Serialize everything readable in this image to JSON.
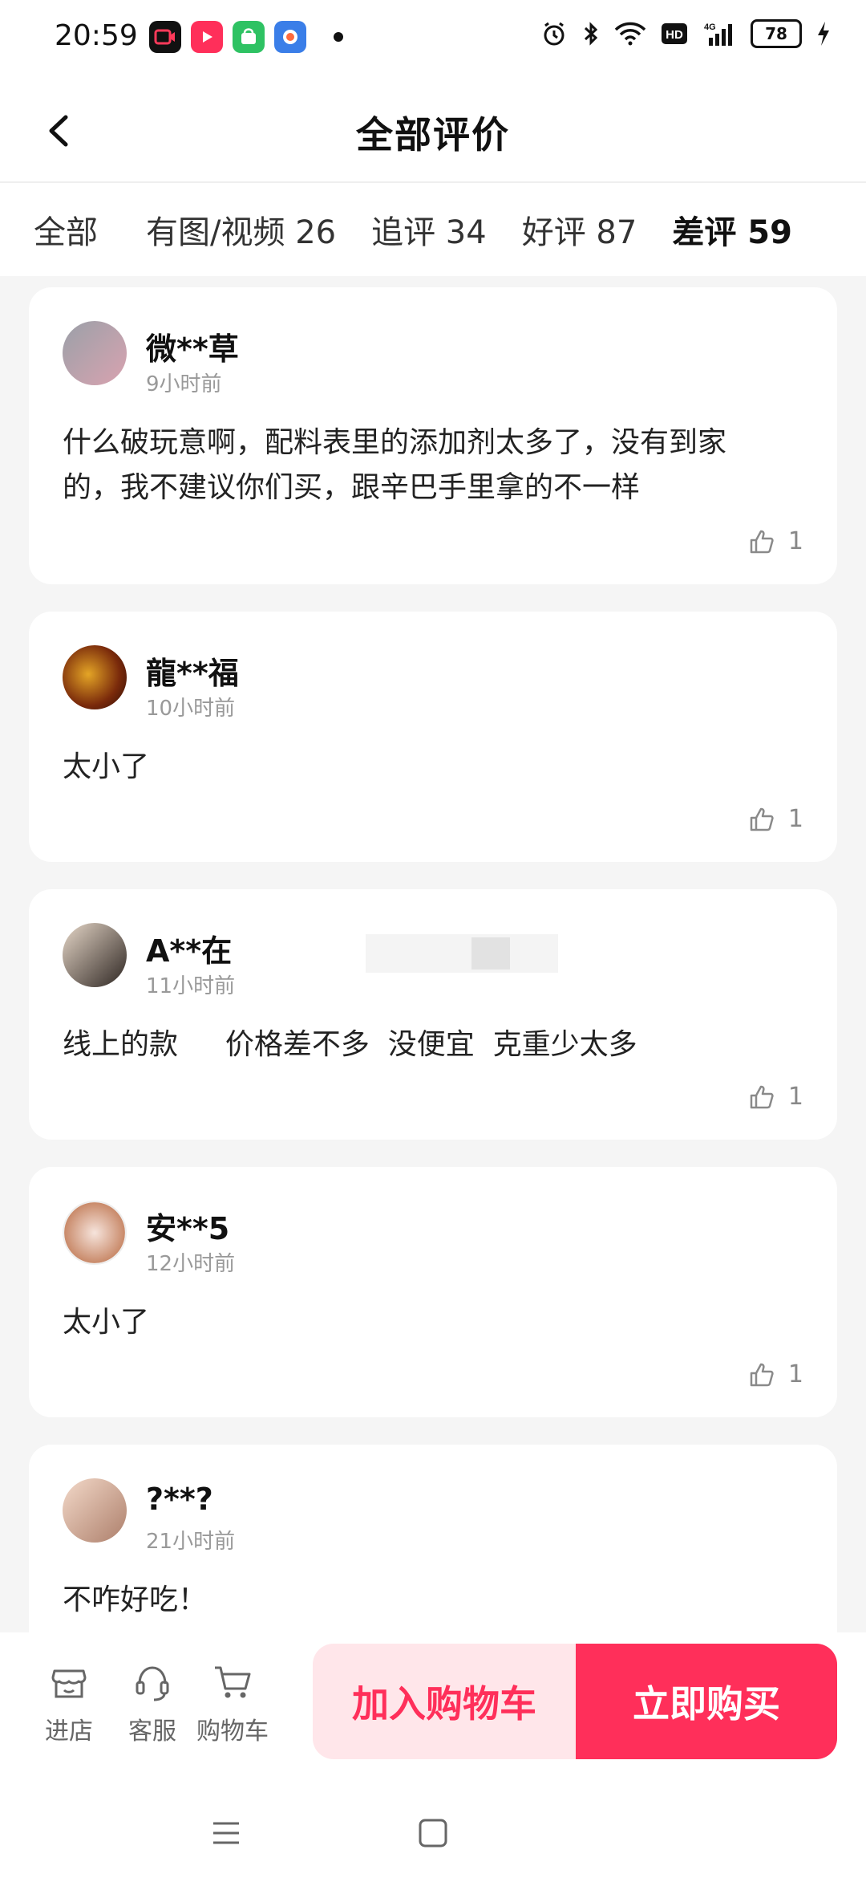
{
  "status_bar": {
    "time": "20:59",
    "battery": "78",
    "app_icons": [
      "screen-recorder-icon",
      "video-app-icon",
      "app-store-icon",
      "browser-app-icon"
    ],
    "system_icons": [
      "alarm-icon",
      "bluetooth-icon",
      "wifi-icon",
      "hd-icon",
      "signal-icon",
      "battery-icon",
      "charging-icon"
    ]
  },
  "header": {
    "title": "全部评价"
  },
  "tabs": [
    {
      "label": "全部"
    },
    {
      "label": "有图/视频 26"
    },
    {
      "label": "追评 34"
    },
    {
      "label": "好评 87"
    },
    {
      "label": "差评 59"
    }
  ],
  "reviews": [
    {
      "user": "微**草",
      "time": "9小时前",
      "text": "什么破玩意啊，配料表里的添加剂太多了，没有到家的，我不建议你们买，跟辛巴手里拿的不一样",
      "likes": "1",
      "avatar_colors": [
        "#9aa0a8",
        "#d9a3b0"
      ]
    },
    {
      "user": "龍**福",
      "time": "10小时前",
      "text": "太小了",
      "likes": "1",
      "avatar_colors": [
        "#2b0b05",
        "#e4a526"
      ]
    },
    {
      "user": "A**在",
      "time": "11小时前",
      "text": "线上的款 　 价格差不多  没便宜  克重少太多",
      "likes": "1",
      "avatar_colors": [
        "#e6d7c8",
        "#2e2622"
      ]
    },
    {
      "user": "安**5",
      "time": "12小时前",
      "text": "太小了",
      "likes": "1",
      "avatar_colors": [
        "#ffffff",
        "#c98a6a"
      ]
    },
    {
      "user": "?**?",
      "time": "21小时前",
      "text": "不咋好吃！",
      "likes": "",
      "avatar_colors": [
        "#f3d9c9",
        "#ad7f6b"
      ]
    }
  ],
  "bottom_bar": {
    "items": [
      {
        "label": "进店",
        "icon": "store-icon"
      },
      {
        "label": "客服",
        "icon": "headset-icon"
      },
      {
        "label": "购物车",
        "icon": "cart-icon"
      }
    ],
    "add_to_cart": "加入购物车",
    "buy_now": "立即购买"
  },
  "colors": {
    "accent": "#ff2f5a",
    "accent_light": "#ffe6ea",
    "background": "#f5f5f5"
  }
}
